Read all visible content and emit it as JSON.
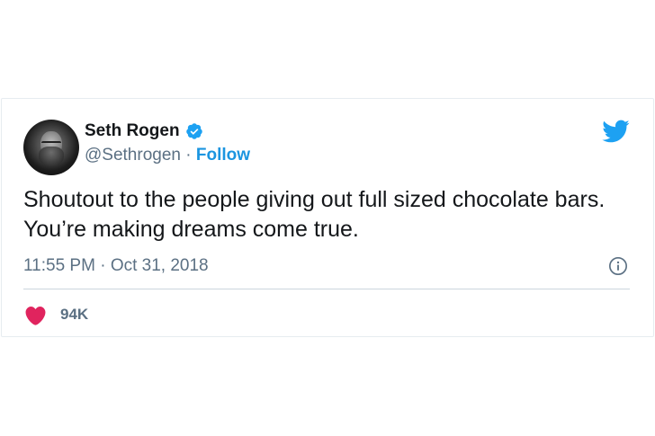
{
  "tweet": {
    "author": {
      "name": "Seth Rogen",
      "handle": "@Sethrogen",
      "separator": "·",
      "follow_label": "Follow",
      "verified": true
    },
    "text": "Shoutout to the people giving out full sized chocolate bars. You’re making dreams come true.",
    "time": "11:55 PM",
    "time_separator": "·",
    "date": "Oct 31, 2018",
    "likes": "94K"
  },
  "icons": {
    "verified": "verified-badge-icon",
    "brand": "twitter-bird-icon",
    "info": "info-icon",
    "like": "heart-icon"
  },
  "colors": {
    "accent": "#1b95e0",
    "verified": "#1da1f2",
    "brand": "#1da1f2",
    "heart": "#e0245e",
    "text": "#14171a",
    "muted": "#5b7083",
    "divider": "#ccd6dd"
  }
}
